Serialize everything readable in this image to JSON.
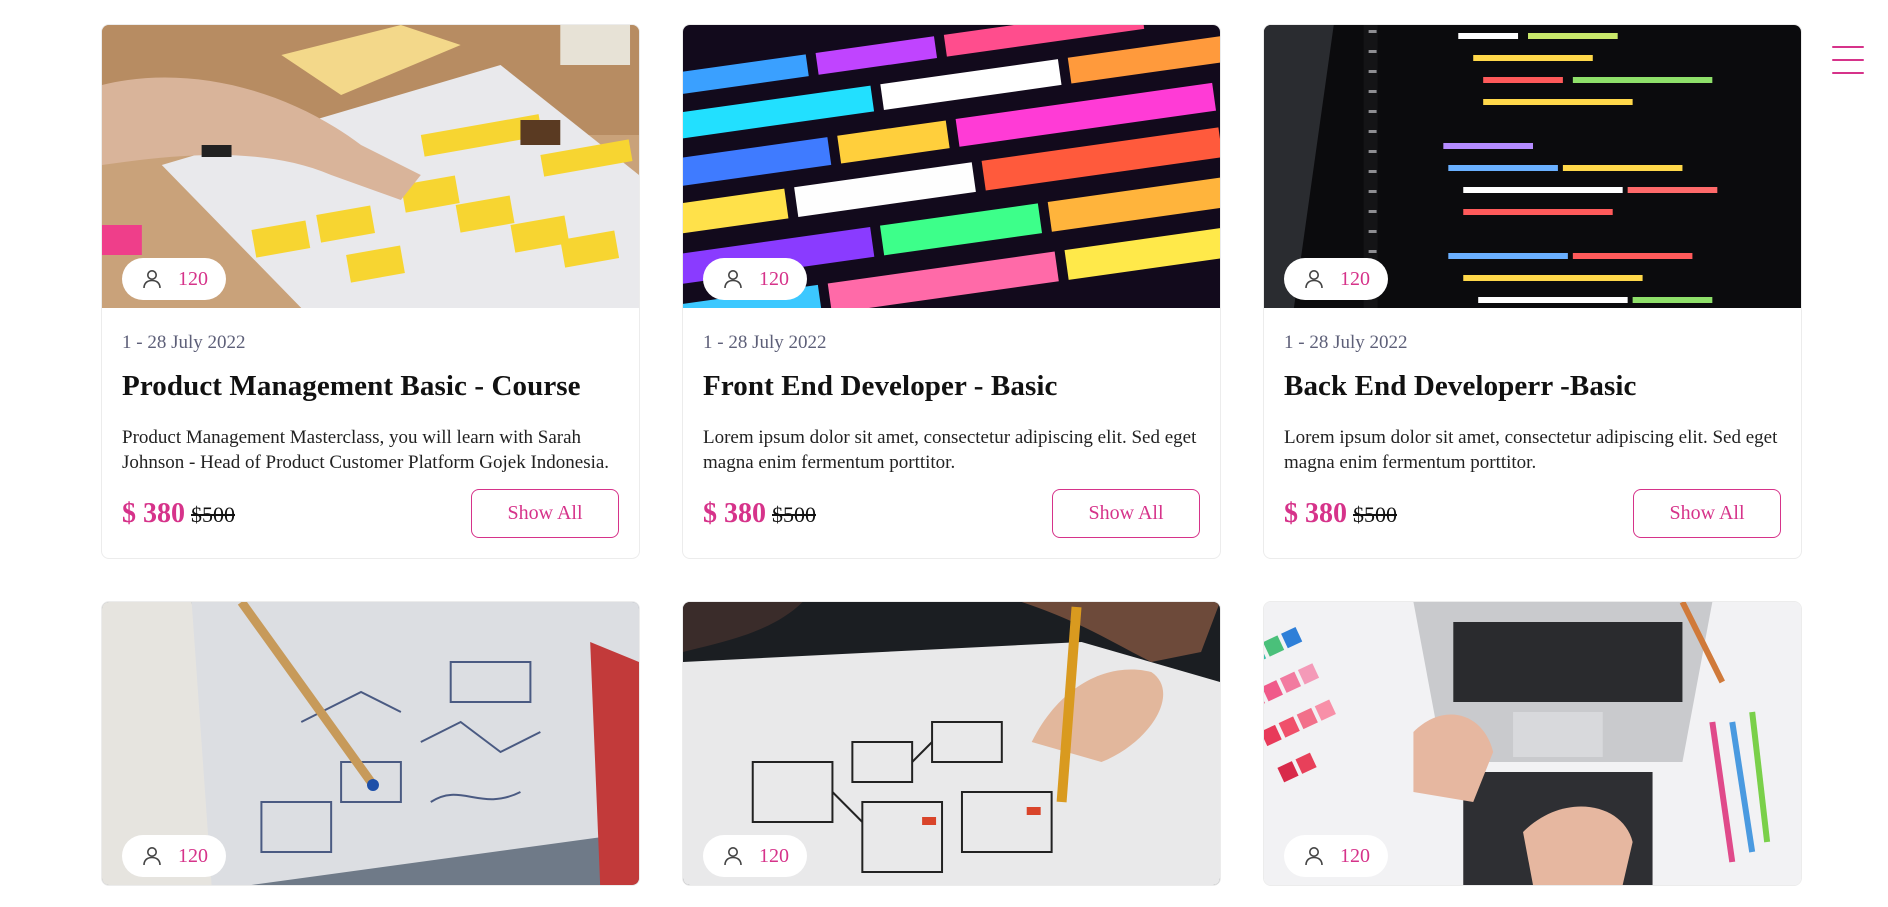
{
  "menu": {
    "icon": "hamburger-menu-icon",
    "accent": "#d6338a"
  },
  "colors": {
    "accent": "#d6338a",
    "date": "#5d5f78"
  },
  "courses": [
    {
      "seats": "120",
      "date": "1 - 28 July 2022",
      "title": "Product Management Basic - Course",
      "description": "Product Management Masterclass, you will learn with Sarah Johnson - Head of Product Customer Platform Gojek Indonesia.",
      "price": "$ 380",
      "old_price": "$500",
      "button": "Show All",
      "image": "sticky-notes-planning-photo"
    },
    {
      "seats": "120",
      "date": "1 - 28 July 2022",
      "title": "Front End Developer - Basic",
      "description": "Lorem ipsum dolor sit amet, consectetur adipiscing elit. Sed eget magna enim fermentum porttitor.",
      "price": "$ 380",
      "old_price": "$500",
      "button": "Show All",
      "image": "colorful-code-screen-photo"
    },
    {
      "seats": "120",
      "date": "1 - 28 July 2022",
      "title": "Back End Developerr -Basic",
      "description": "Lorem ipsum dolor sit amet, consectetur adipiscing elit. Sed eget magna enim fermentum porttitor.",
      "price": "$ 380",
      "old_price": "$500",
      "button": "Show All",
      "image": "python-code-monitor-photo"
    },
    {
      "seats": "120",
      "image": "notebook-sketch-photo"
    },
    {
      "seats": "120",
      "image": "wireframe-drawing-photo"
    },
    {
      "seats": "120",
      "image": "designer-laptop-swatches-photo"
    }
  ]
}
